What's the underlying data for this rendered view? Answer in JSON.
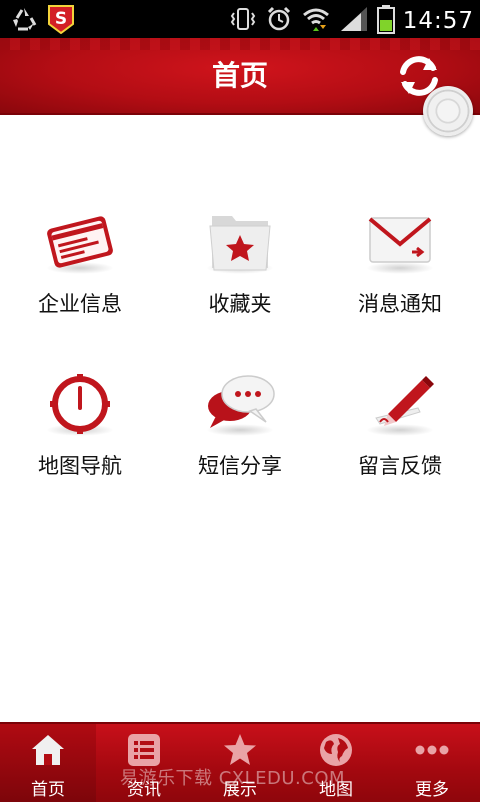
{
  "status_bar": {
    "time": "14:57",
    "icons": [
      "recycle-icon",
      "s-app-icon",
      "vibrate-icon",
      "alarm-icon",
      "wifi-icon",
      "signal-icon",
      "battery-icon"
    ]
  },
  "header": {
    "title": "首页",
    "refresh_icon": "refresh-icon",
    "color": "#b30d14"
  },
  "grid": {
    "items": [
      {
        "label": "企业信息",
        "icon": "business-card-icon"
      },
      {
        "label": "收藏夹",
        "icon": "favorites-folder-icon"
      },
      {
        "label": "消息通知",
        "icon": "envelope-icon"
      },
      {
        "label": "地图导航",
        "icon": "compass-icon"
      },
      {
        "label": "短信分享",
        "icon": "chat-bubbles-icon"
      },
      {
        "label": "留言反馈",
        "icon": "pen-feedback-icon"
      }
    ]
  },
  "tabbar": {
    "tabs": [
      {
        "label": "首页",
        "icon": "home-icon",
        "active": true
      },
      {
        "label": "资讯",
        "icon": "news-list-icon",
        "active": false
      },
      {
        "label": "展示",
        "icon": "star-icon",
        "active": false
      },
      {
        "label": "地图",
        "icon": "globe-icon",
        "active": false
      },
      {
        "label": "更多",
        "icon": "more-dots-icon",
        "active": false
      }
    ]
  },
  "watermark": {
    "text": "易游乐下载 CXLEDU.COM"
  }
}
